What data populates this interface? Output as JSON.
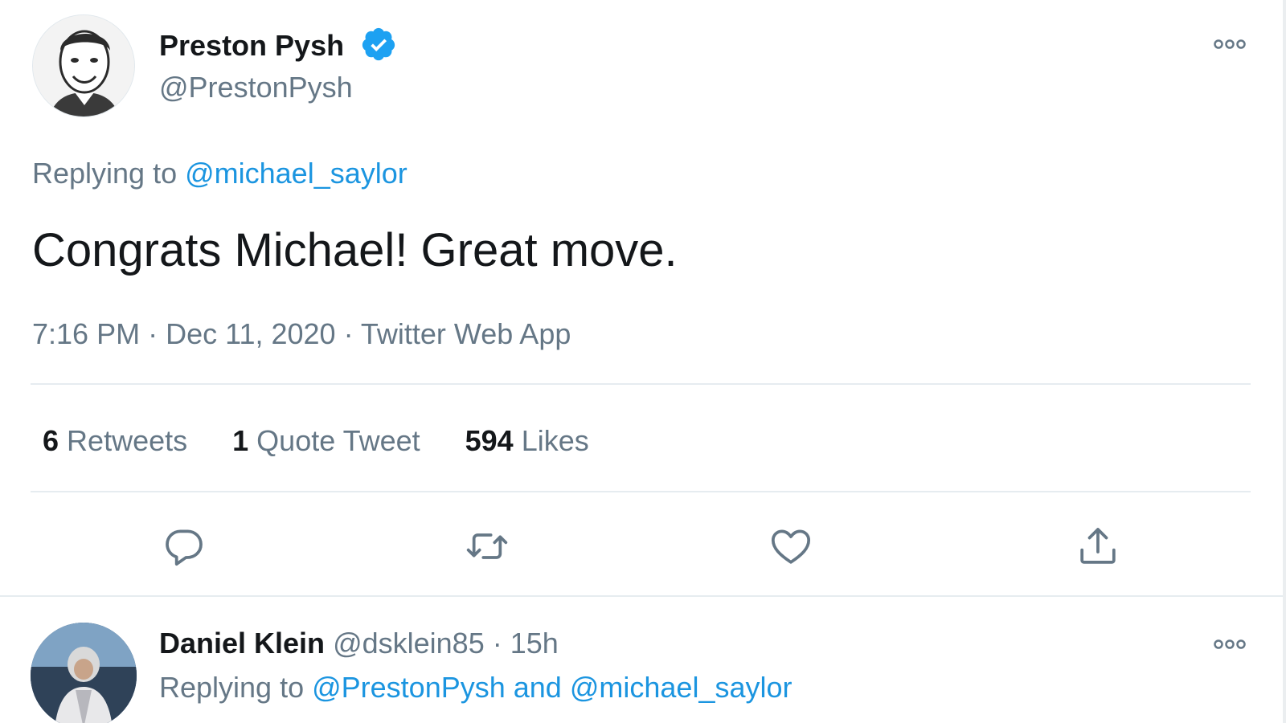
{
  "tweet": {
    "author_name": "Preston Pysh",
    "author_handle": "@PrestonPysh",
    "replying_prefix": "Replying to ",
    "replying_to": "@michael_saylor",
    "text": "Congrats Michael!  Great move.",
    "time": "7:16 PM",
    "date": "Dec 11, 2020",
    "source": "Twitter Web App",
    "separator": " · ",
    "stats": {
      "retweets_count": "6",
      "retweets_label": "Retweets",
      "quotes_count": "1",
      "quotes_label": "Quote Tweet",
      "likes_count": "594",
      "likes_label": "Likes"
    }
  },
  "reply": {
    "author_name": "Daniel Klein",
    "author_handle": "@dsklein85",
    "separator": " · ",
    "time": "15h",
    "replying_prefix": "Replying to ",
    "replying_to_1": "@PrestonPysh",
    "replying_joiner": " and ",
    "replying_to_2": "@michael_saylor"
  },
  "icons": {
    "verified": "verified-badge-icon",
    "more": "more-options-icon",
    "reply": "reply-icon",
    "retweet": "retweet-icon",
    "like": "heart-icon",
    "share": "share-icon"
  },
  "colors": {
    "link": "#1b95e0",
    "secondary_text": "#657786",
    "primary_text": "#14171a",
    "divider": "#e6ecf0"
  }
}
